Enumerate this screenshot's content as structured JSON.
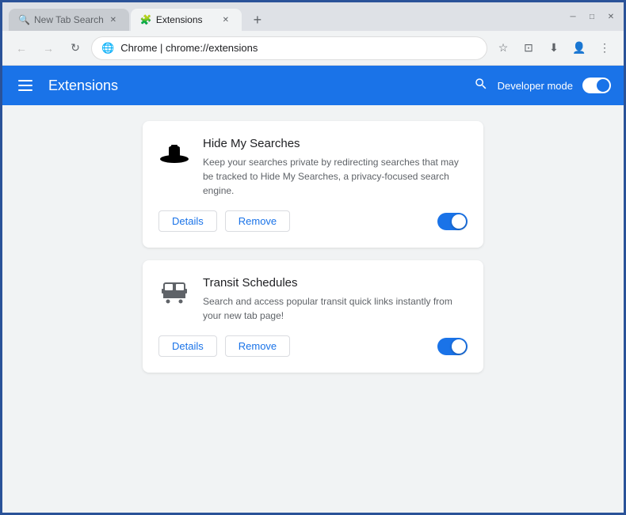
{
  "browser": {
    "tabs": [
      {
        "id": "tab-new-tab-search",
        "title": "New Tab Search",
        "active": false,
        "icon": "🔍",
        "closable": true
      },
      {
        "id": "tab-extensions",
        "title": "Extensions",
        "active": true,
        "icon": "🧩",
        "closable": true
      }
    ],
    "new_tab_label": "+",
    "window_controls": {
      "minimize": "─",
      "maximize": "□",
      "close": "✕"
    }
  },
  "toolbar": {
    "back_label": "←",
    "forward_label": "→",
    "reload_label": "↻",
    "address": {
      "protocol": "Chrome",
      "separator": " | ",
      "path": "chrome://extensions"
    },
    "bookmark_icon": "☆",
    "cast_icon": "⊡",
    "download_icon": "⬇",
    "profile_icon": "👤",
    "menu_icon": "⋮"
  },
  "extensions_page": {
    "header": {
      "menu_icon": "hamburger",
      "title": "Extensions",
      "search_icon": "search",
      "developer_mode_label": "Developer mode",
      "toggle_on": true
    },
    "extensions": [
      {
        "id": "hide-my-searches",
        "name": "Hide My Searches",
        "description": "Keep your searches private by redirecting searches that may be tracked to Hide My Searches, a privacy-focused search engine.",
        "icon": "🎩",
        "enabled": true,
        "details_label": "Details",
        "remove_label": "Remove"
      },
      {
        "id": "transit-schedules",
        "name": "Transit Schedules",
        "description": "Search and access popular transit quick links instantly from your new tab page!",
        "icon": "🚌",
        "enabled": true,
        "details_label": "Details",
        "remove_label": "Remove"
      }
    ]
  }
}
